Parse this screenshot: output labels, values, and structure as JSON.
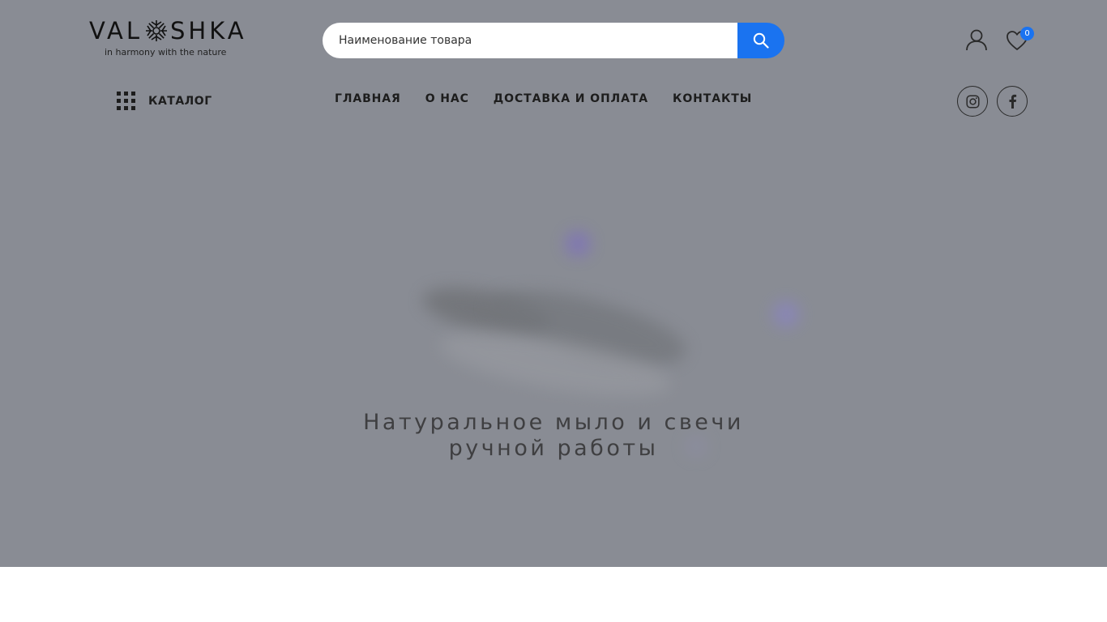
{
  "header": {
    "logo": {
      "wordmark": "VALOSHKA",
      "tagline": "in harmony with the nature"
    },
    "search": {
      "placeholder": "Наименование товара"
    },
    "wishlist_count": "0"
  },
  "nav": {
    "catalog_label": "КАТАЛОГ",
    "items": [
      {
        "label": "ГЛАВНАЯ"
      },
      {
        "label": "О НАС"
      },
      {
        "label": "ДОСТАВКА И ОПЛАТА"
      },
      {
        "label": "КОНТАКТЫ"
      }
    ],
    "social": [
      "instagram-icon",
      "facebook-icon"
    ]
  },
  "hero": {
    "title_line1": "Натуральное мыло и свечи",
    "title_line2": "ручной работы"
  },
  "colors": {
    "accent": "#1a73f0",
    "hero_overlay": "#898c94",
    "text_dark": "#1d1d1d"
  }
}
